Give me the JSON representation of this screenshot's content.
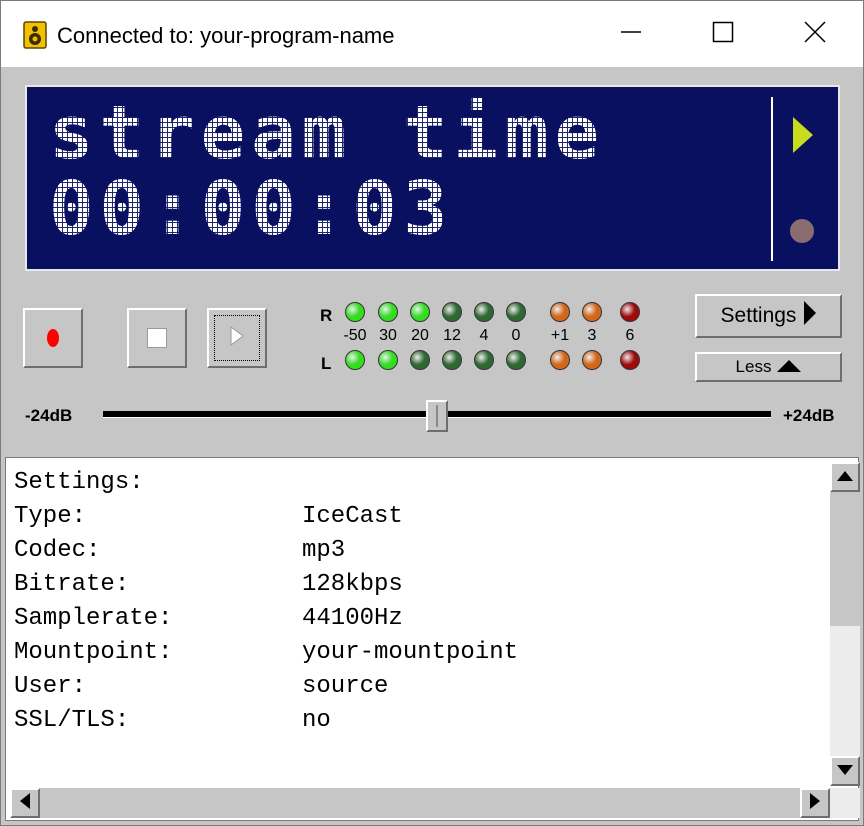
{
  "window": {
    "title": "Connected to: your-program-name"
  },
  "display": {
    "line1": "stream time",
    "line2": "00:00:03"
  },
  "meter": {
    "right_label": "R",
    "left_label": "L",
    "scale": [
      "-50",
      "30",
      "20",
      "12",
      "4",
      "0",
      "+1",
      "3",
      "6"
    ],
    "right_leds": [
      "lit-green",
      "lit-green",
      "lit-green",
      "dim-green",
      "dim-green",
      "dim-green",
      "orange",
      "orange",
      "red"
    ],
    "left_leds": [
      "lit-green",
      "lit-green",
      "dim-green",
      "dim-green",
      "dim-green",
      "dim-green",
      "orange",
      "orange",
      "red"
    ]
  },
  "buttons": {
    "settings": "Settings",
    "less": "Less"
  },
  "slider": {
    "min_label": "-24dB",
    "max_label": "+24dB",
    "value_fraction": 0.5
  },
  "settings_panel": {
    "heading": "Settings:",
    "rows": [
      {
        "key": "Type:",
        "value": "IceCast"
      },
      {
        "key": "Codec:",
        "value": "mp3"
      },
      {
        "key": "Bitrate:",
        "value": "128kbps"
      },
      {
        "key": "Samplerate:",
        "value": "44100Hz"
      },
      {
        "key": "Mountpoint:",
        "value": "your-mountpoint"
      },
      {
        "key": "User:",
        "value": "source"
      },
      {
        "key": "SSL/TLS:",
        "value": "no"
      }
    ]
  },
  "colors": {
    "display_bg": "#0a1060",
    "led_lit_green": "#33dd22",
    "led_dim_green": "#2f6a36",
    "led_orange": "#d2661a",
    "led_red": "#a00a0a",
    "record_red": "#ff0000",
    "indicator_arrow": "#c8dc1e",
    "indicator_dot": "#8a6c70"
  },
  "icons": {
    "app": "speaker-icon",
    "minimize": "minimize-icon",
    "maximize": "maximize-icon",
    "close": "close-icon",
    "record": "record-icon",
    "stop": "stop-icon",
    "play": "play-icon"
  }
}
